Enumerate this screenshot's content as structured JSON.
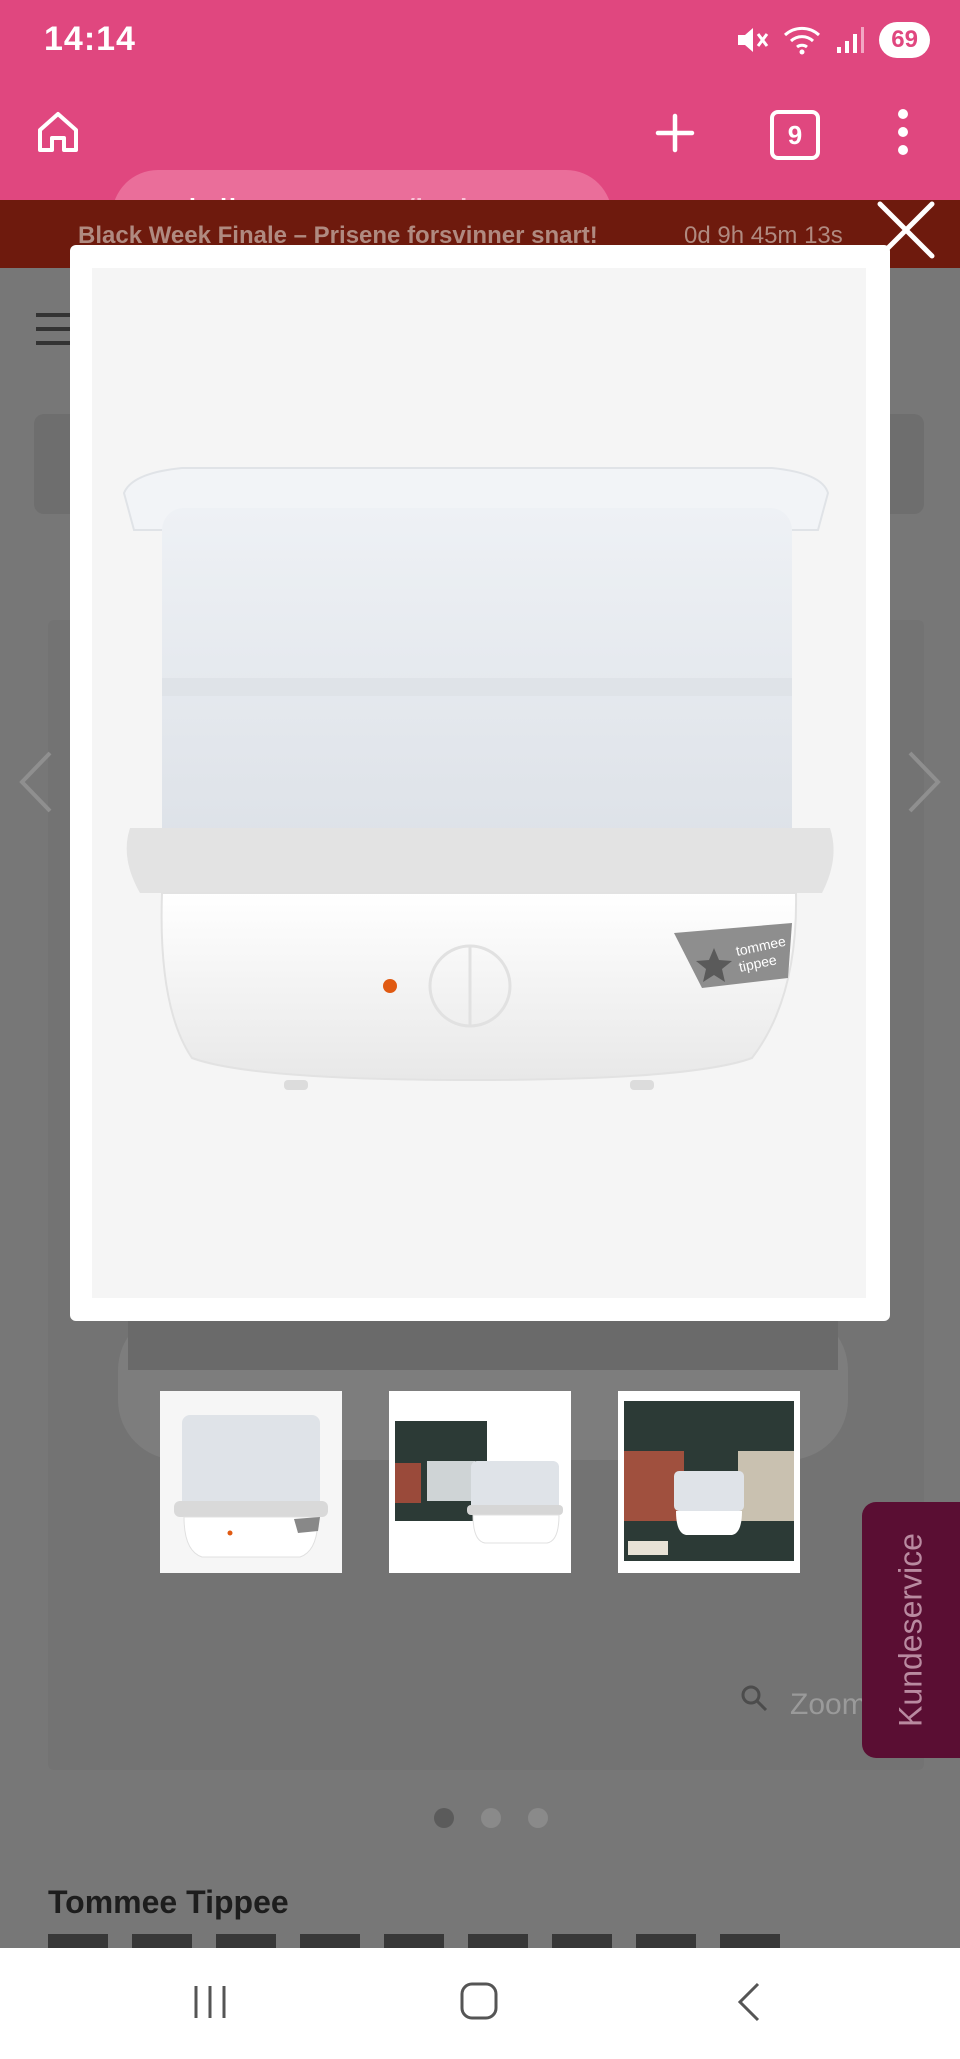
{
  "status": {
    "time": "14:14",
    "battery": "69",
    "icons": [
      "mute-icon",
      "wifi-icon",
      "signal-icon"
    ]
  },
  "browser": {
    "url_host": "jollyroom.no",
    "url_path": "/babyutst",
    "tab_count": "9",
    "icons": [
      "home-icon",
      "site-settings-icon",
      "new-tab-icon",
      "tabs-icon",
      "menu-icon"
    ]
  },
  "banner": {
    "text": "Black Week Finale – Prisene forsvinner snart!",
    "countdown": "0d 9h 45m 13s"
  },
  "gallery": {
    "zoom_label": "Zoom",
    "thumbnails": [
      "thumbnail-1",
      "thumbnail-2",
      "thumbnail-3"
    ],
    "active_dot": 1,
    "dot_count": 3
  },
  "product": {
    "brand": "Tommee Tippee",
    "logo_text": "tommee tippee"
  },
  "customer_service": {
    "label": "Kundeservice"
  },
  "colors": {
    "brand_pink": "#e0477f",
    "banner_red": "#6e1a0d",
    "kundeservice": "#5a0e33"
  }
}
